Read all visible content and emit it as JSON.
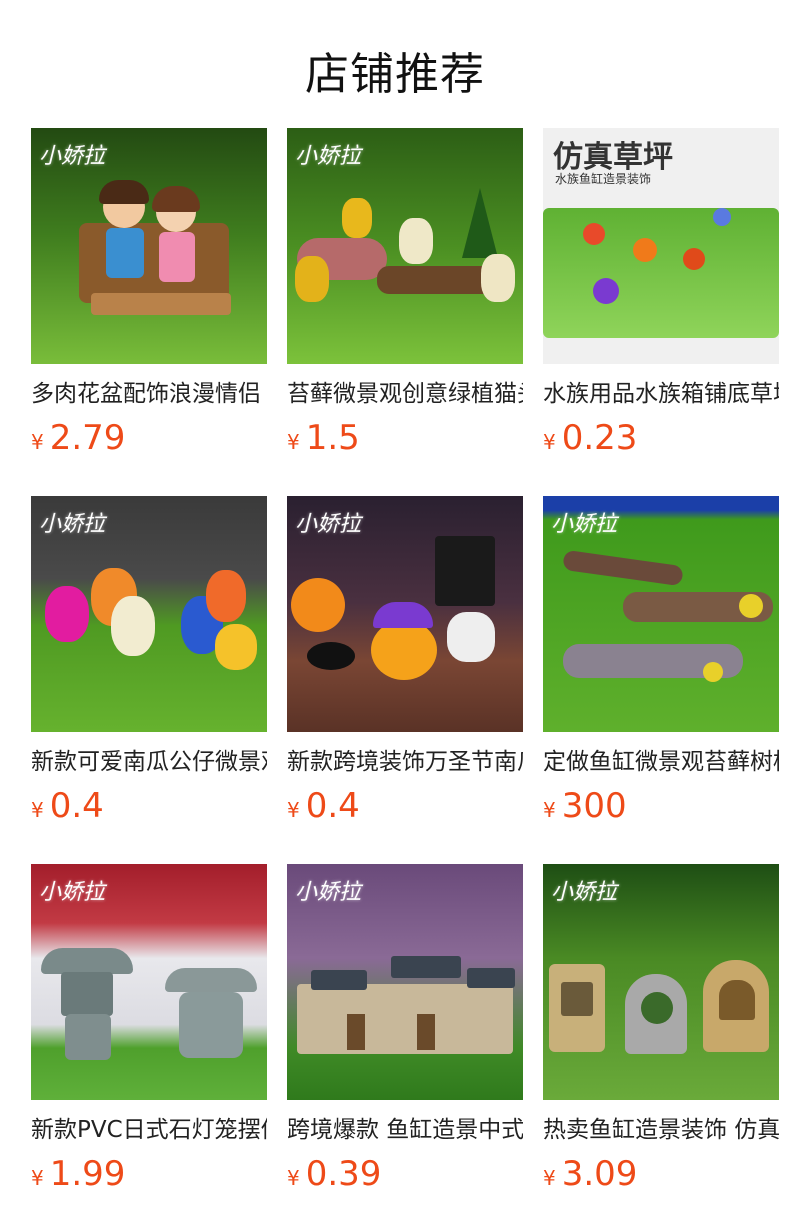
{
  "header": {
    "title": "店铺推荐"
  },
  "currency": "¥",
  "products": [
    {
      "name": "多肉花盆配饰浪漫情侣",
      "price": "2.79",
      "brand": "小娇拉",
      "image": "couple-on-bench",
      "colors": [
        "#3b7a1f",
        "#6fb12e"
      ]
    },
    {
      "name": "苔藓微景观创意绿植猫头鹰",
      "price": "1.5",
      "brand": "小娇拉",
      "image": "owls-on-log",
      "colors": [
        "#2f6a16",
        "#5ea42a"
      ]
    },
    {
      "name": "水族用品水族箱铺底草坪",
      "price": "0.23",
      "brand": "小娇拉",
      "image": "artificial-lawn",
      "overlay_title": "仿真草坪",
      "overlay_sub": "水族鱼缸造景装饰",
      "colors": [
        "#f2f2f2",
        "#79c34a"
      ]
    },
    {
      "name": "新款可爱南瓜公仔微景观",
      "price": "0.4",
      "brand": "小娇拉",
      "image": "pumpkin-figures",
      "colors": [
        "#444",
        "#5aa326"
      ]
    },
    {
      "name": "新款跨境装饰万圣节南瓜",
      "price": "0.4",
      "brand": "小娇拉",
      "image": "halloween-decor",
      "colors": [
        "#3a2a3a",
        "#7a4a36"
      ]
    },
    {
      "name": "定做鱼缸微景观苔藓树枝",
      "price": "300",
      "brand": "小娇拉",
      "image": "tree-branches",
      "colors": [
        "#1b3fa8",
        "#4eaa22"
      ]
    },
    {
      "name": "新款PVC日式石灯笼摆件",
      "price": "1.99",
      "brand": "小娇拉",
      "image": "stone-lanterns",
      "colors": [
        "#a31e2b",
        "#59a83a"
      ]
    },
    {
      "name": "跨境爆款 鱼缸造景中式",
      "price": "0.39",
      "brand": "小娇拉",
      "image": "chinese-houses",
      "colors": [
        "#7a5a8a",
        "#3f8a26"
      ]
    },
    {
      "name": "热卖鱼缸造景装饰 仿真",
      "price": "3.09",
      "brand": "小娇拉",
      "image": "fairy-windows",
      "colors": [
        "#2e6e1c",
        "#6aa83a"
      ]
    }
  ]
}
